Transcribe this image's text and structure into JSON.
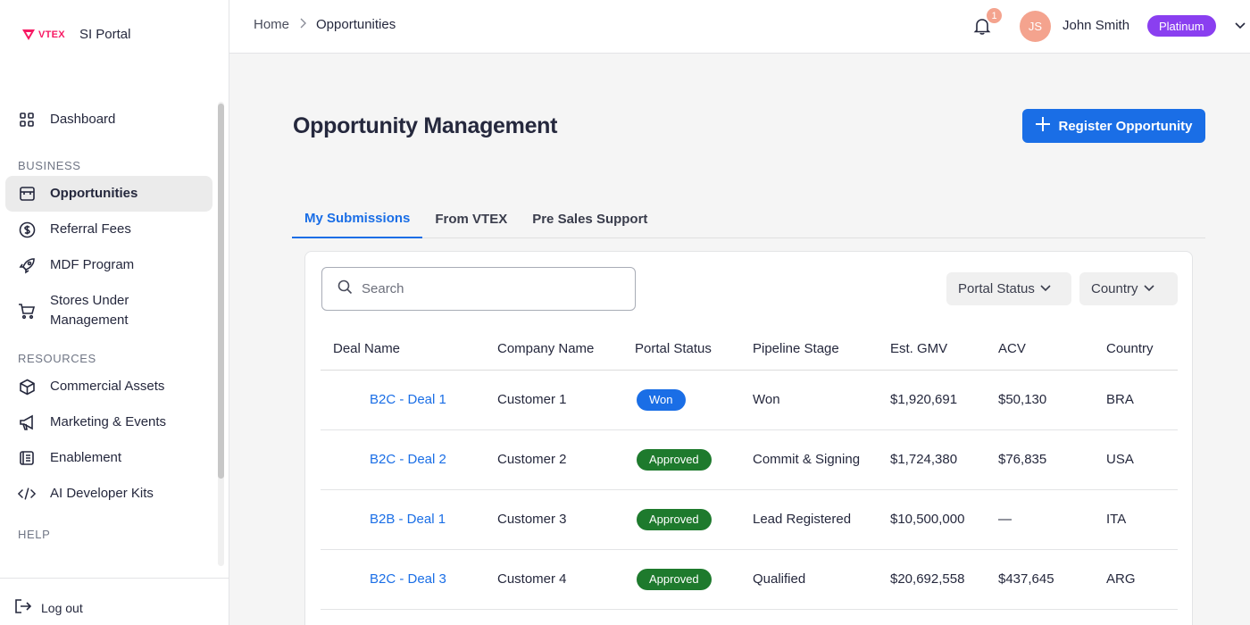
{
  "brand": {
    "logo_text": "VTEX",
    "name": "SI Portal"
  },
  "sidebar": {
    "dashboard": "Dashboard",
    "sections": {
      "business": "BUSINESS",
      "resources": "RESOURCES",
      "help": "HELP"
    },
    "business_items": [
      {
        "label": "Opportunities",
        "icon": "store-icon",
        "active": true
      },
      {
        "label": "Referral Fees",
        "icon": "dollar-circle-icon"
      },
      {
        "label": "MDF Program",
        "icon": "rocket-icon"
      },
      {
        "label": "Stores Under Management",
        "icon": "cart-icon"
      }
    ],
    "resources_items": [
      {
        "label": "Commercial Assets",
        "icon": "box-icon"
      },
      {
        "label": "Marketing & Events",
        "icon": "megaphone-icon"
      },
      {
        "label": "Enablement",
        "icon": "document-icon"
      },
      {
        "label": "AI Developer Kits",
        "icon": "code-icon"
      }
    ],
    "logout": "Log out"
  },
  "topbar": {
    "breadcrumb": {
      "home": "Home",
      "current": "Opportunities"
    },
    "notifications": "1",
    "user": {
      "initials": "JS",
      "name": "John Smith",
      "tier": "Platinum"
    }
  },
  "main": {
    "title": "Opportunity Management",
    "register_button": "Register Opportunity",
    "tabs": [
      "My Submissions",
      "From VTEX",
      "Pre Sales Support"
    ],
    "active_tab": "My Submissions",
    "search_placeholder": "Search",
    "filters": {
      "portal_status": "Portal Status",
      "country": "Country"
    }
  },
  "table": {
    "columns": [
      "Deal Name",
      "Company Name",
      "Portal Status",
      "Pipeline Stage",
      "Est. GMV",
      "ACV",
      "Country"
    ],
    "rows": [
      {
        "deal": "B2C - Deal 1",
        "company": "Customer 1",
        "status": "Won",
        "stage": "Won",
        "gmv": "$1,920,691",
        "acv": "$50,130",
        "country": "BRA"
      },
      {
        "deal": "B2C - Deal 2",
        "company": "Customer 2",
        "status": "Approved",
        "stage": "Commit & Signing",
        "gmv": "$1,724,380",
        "acv": "$76,835",
        "country": "USA"
      },
      {
        "deal": "B2B - Deal 1",
        "company": "Customer 3",
        "status": "Approved",
        "stage": "Lead Registered",
        "gmv": "$10,500,000",
        "acv": "—",
        "country": "ITA"
      },
      {
        "deal": "B2C - Deal 3",
        "company": "Customer 4",
        "status": "Approved",
        "stage": "Qualified",
        "gmv": "$20,692,558",
        "acv": "$437,645",
        "country": "ARG"
      }
    ]
  },
  "colors": {
    "primary": "#1a6ee6",
    "won": "#1a6ee6",
    "approved": "#1e7a2d",
    "tier": "#8a3ff0",
    "avatar": "#f4a38e",
    "brand": "#f71963"
  }
}
